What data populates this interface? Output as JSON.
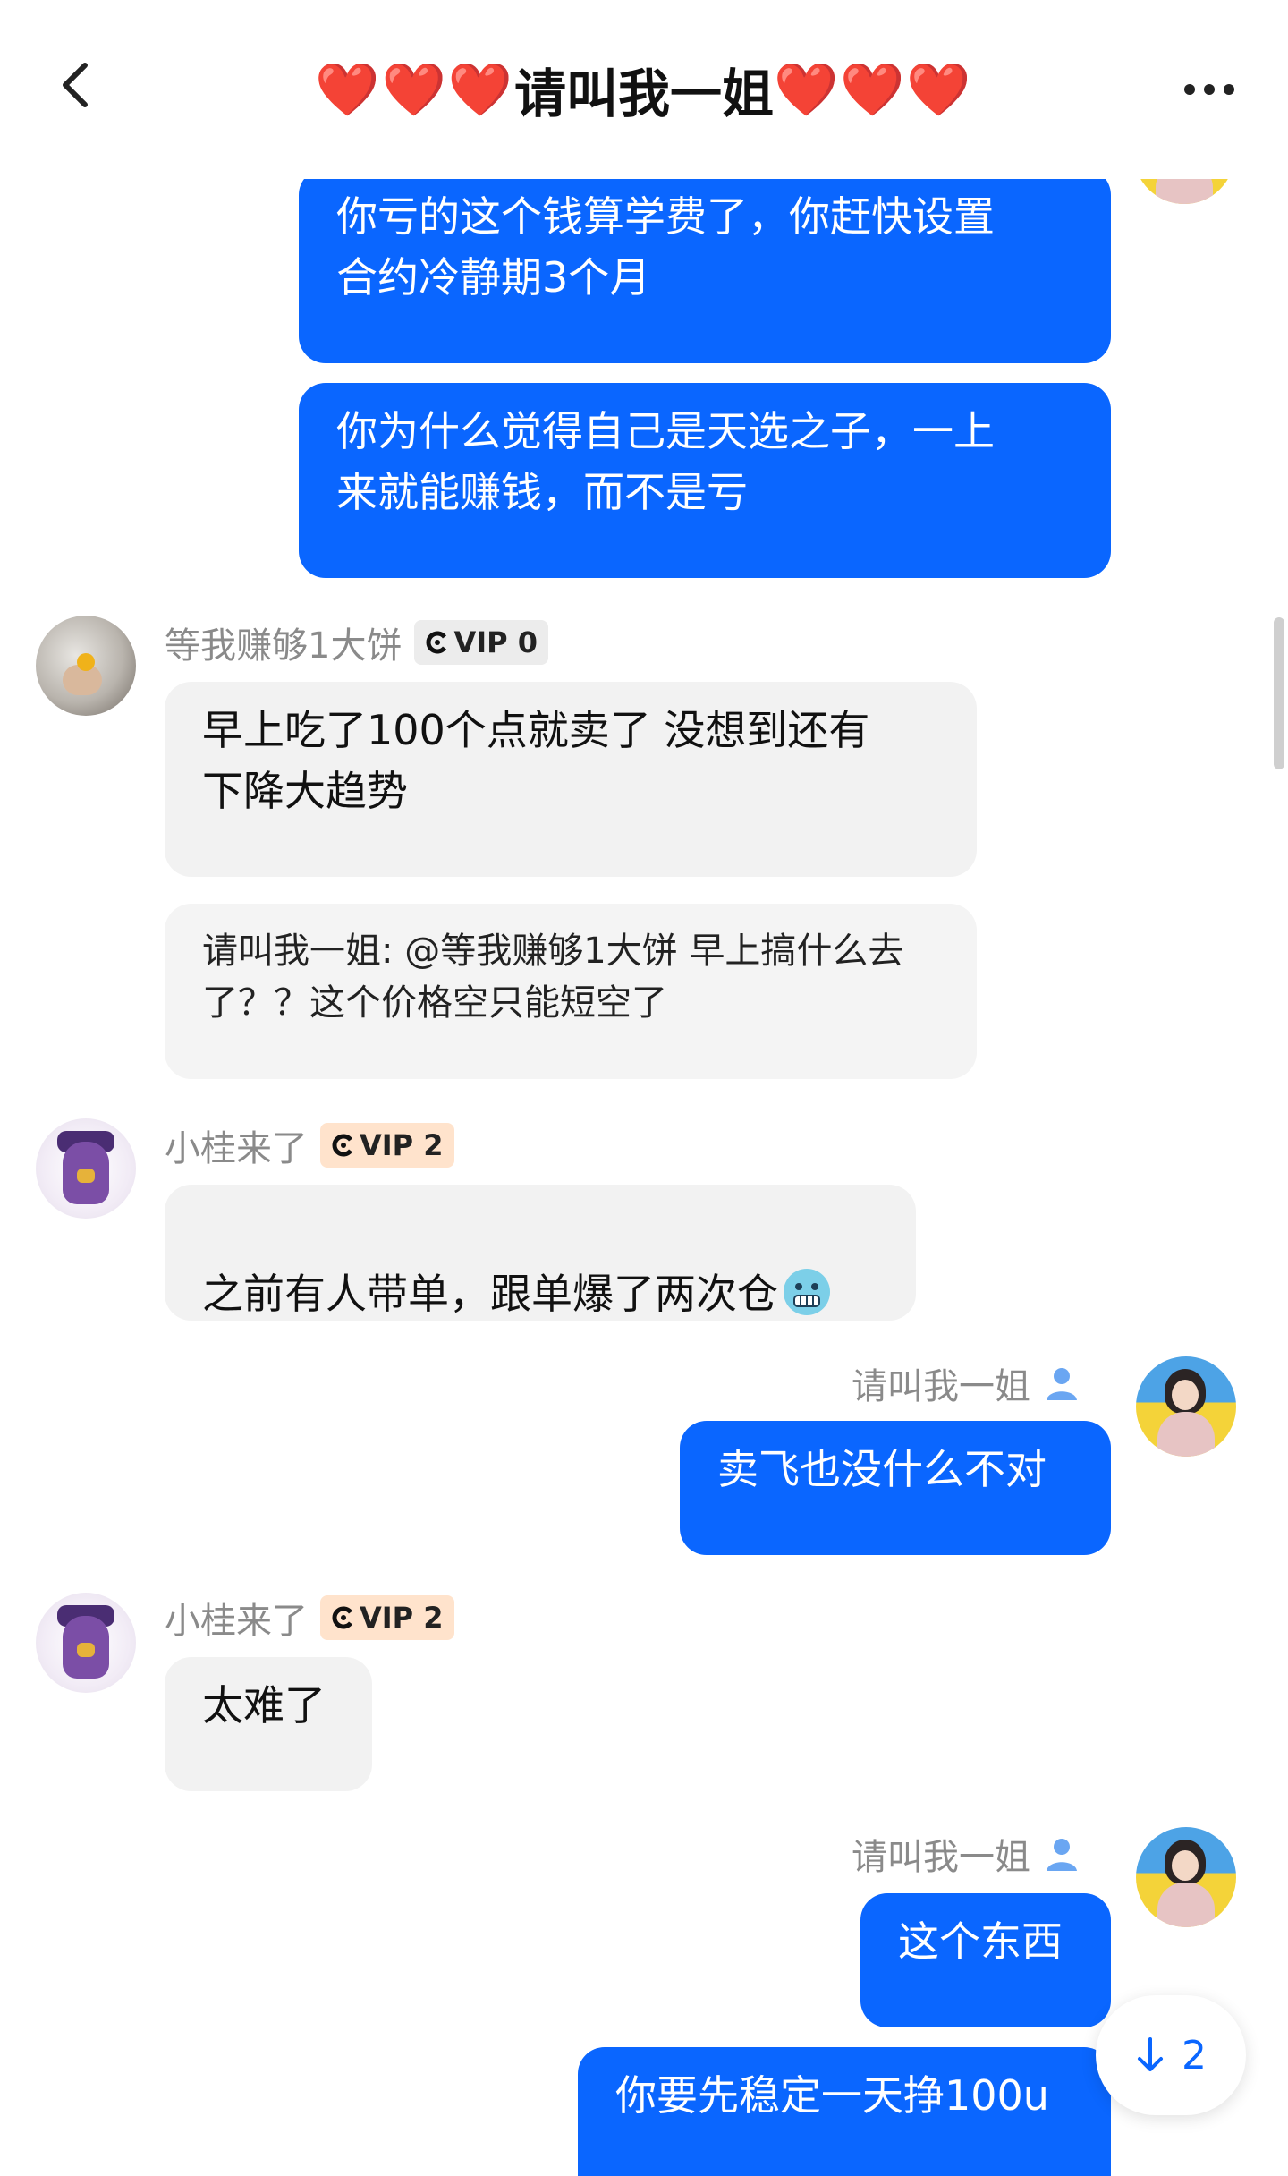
{
  "header": {
    "title_hearts_left": "❤️❤️❤️",
    "title_name": "请叫我一姐",
    "title_hearts_right": "❤️❤️❤️",
    "back_icon": "chevron-left-icon",
    "more_icon": "more-dots-icon"
  },
  "messages": {
    "m1": {
      "text": "你亏的这个钱算学费了，你赶快设置\n合约冷静期3个月"
    },
    "m2": {
      "text": "你为什么觉得自己是天选之子，一上\n来就能赚钱，而不是亏"
    },
    "m3": {
      "sender": "等我赚够1大饼",
      "vip": "VIP 0",
      "text": "早上吃了100个点就卖了 没想到还有\n下降大趋势"
    },
    "m4": {
      "text": "请叫我一姐: @等我赚够1大饼 早上搞什么去\n了？？这个价格空只能短空了"
    },
    "m5": {
      "sender": "小桂来了",
      "vip": "VIP 2",
      "text": "之前有人带单，跟单爆了两次仓",
      "emoji": "cold-face-emoji"
    },
    "m6": {
      "sender": "请叫我一姐",
      "text": "卖飞也没什么不对"
    },
    "m7": {
      "sender": "小桂来了",
      "vip": "VIP 2",
      "text": "太难了"
    },
    "m8": {
      "sender": "请叫我一姐",
      "text": "这个东西"
    },
    "m9": {
      "text": "你要先稳定一天挣100u"
    }
  },
  "jump_button": {
    "count": "2",
    "icon": "arrow-down-icon"
  },
  "colors": {
    "accent": "#0a66ff",
    "hearts": "#e0192f",
    "vip2_bg": "#ffe3cc",
    "vip0_bg": "#ececec",
    "incoming_bg": "#f2f2f2"
  }
}
